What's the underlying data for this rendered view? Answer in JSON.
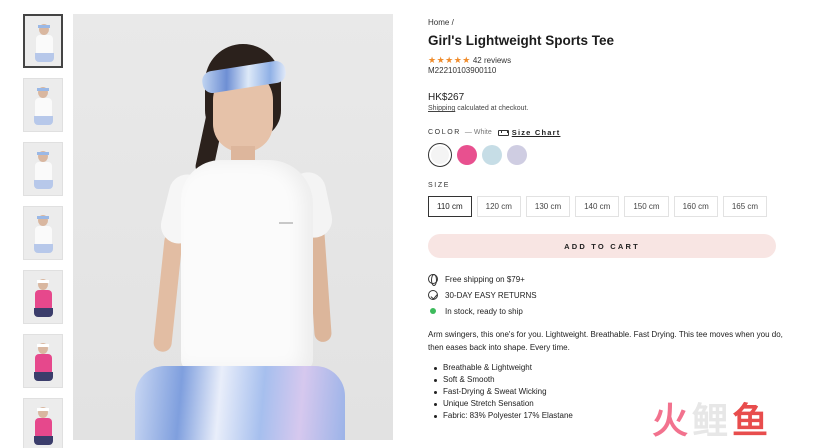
{
  "thumbnails": [
    {
      "variant": "white-front",
      "active": true
    },
    {
      "variant": "white-side",
      "active": false
    },
    {
      "variant": "white-headband",
      "active": false
    },
    {
      "variant": "white-action",
      "active": false
    },
    {
      "variant": "pink-front",
      "active": false
    },
    {
      "variant": "pink-side",
      "active": false
    },
    {
      "variant": "pink-close",
      "active": false
    }
  ],
  "breadcrumb": {
    "home": "Home",
    "separator": "/"
  },
  "product": {
    "title": "Girl's Lightweight Sports Tee",
    "stars": "★★★★★",
    "rating_value": 5,
    "reviews": "42 reviews",
    "sku": "M22210103900110",
    "price": "HK$267",
    "shipping_link": "Shipping",
    "shipping_rest": " calculated at checkout."
  },
  "color": {
    "label": "COLOR",
    "value": "— White",
    "size_chart_label": "Size Chart",
    "size_chart_icon": "ruler-icon",
    "swatches": [
      {
        "name": "White",
        "hex": "#f4f4f4",
        "selected": true
      },
      {
        "name": "Pink",
        "hex": "#e8508f",
        "selected": false
      },
      {
        "name": "Light Blue",
        "hex": "#c6dde6",
        "selected": false
      },
      {
        "name": "Lavender",
        "hex": "#cfcde2",
        "selected": false
      }
    ]
  },
  "size": {
    "label": "SIZE",
    "options": [
      "110 cm",
      "120 cm",
      "130 cm",
      "140 cm",
      "150 cm",
      "160 cm",
      "165 cm"
    ],
    "selected": "110 cm"
  },
  "cart": {
    "add_label": "ADD TO CART",
    "button_color": "#f8e5e3"
  },
  "benefits": [
    {
      "icon": "globe-icon",
      "text": "Free shipping on $79+"
    },
    {
      "icon": "check-circle-icon",
      "text": "30-DAY EASY RETURNS"
    },
    {
      "icon": "in-stock-dot-icon",
      "text": "In stock, ready to ship",
      "color": "#3dbb5c"
    }
  ],
  "description": "Arm swingers, this one's for you. Lightweight. Breathable. Fast Drying. This tee moves when you do, then eases back into shape. Every time.",
  "features": [
    "Breathable & Lightweight",
    "Soft & Smooth",
    "Fast-Drying & Sweat Wicking",
    "Unique Stretch Sensation",
    "Fabric: 83% Polyester 17% Elastane"
  ],
  "watermark": {
    "chars": [
      "火",
      "鲤",
      "鱼"
    ],
    "colors": [
      "#f2728e",
      "#e7e7e7",
      "#e84d4d"
    ]
  }
}
